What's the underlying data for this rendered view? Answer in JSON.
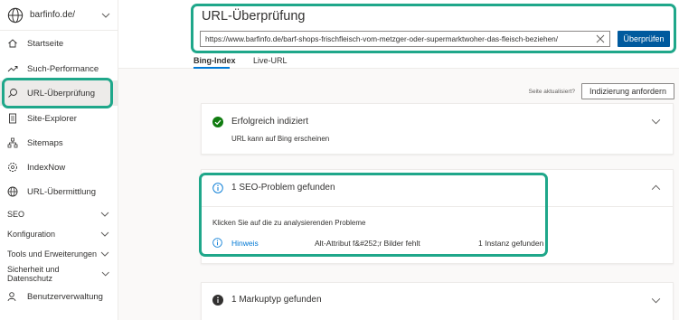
{
  "site": {
    "name": "barfinfo.de/"
  },
  "sidebar": {
    "items": [
      {
        "label": "Startseite",
        "icon": "home-icon"
      },
      {
        "label": "Such-Performance",
        "icon": "trend-icon"
      },
      {
        "label": "URL-Überprüfung",
        "icon": "search-icon"
      },
      {
        "label": "Site-Explorer",
        "icon": "document-icon"
      },
      {
        "label": "Sitemaps",
        "icon": "sitemap-icon"
      },
      {
        "label": "IndexNow",
        "icon": "indexnow-icon"
      },
      {
        "label": "URL-Übermittlung",
        "icon": "globe-icon"
      }
    ],
    "sections": [
      {
        "label": "SEO"
      },
      {
        "label": "Konfiguration"
      },
      {
        "label": "Tools und Erweiterungen"
      },
      {
        "label": "Sicherheit und Datenschutz"
      }
    ],
    "user_management": {
      "label": "Benutzerverwaltung",
      "icon": "users-icon"
    }
  },
  "header": {
    "title": "URL-Überprüfung",
    "url_value": "https://www.barfinfo.de/barf-shops-frischfleisch-vom-metzger-oder-supermarktwoher-das-fleisch-beziehen/",
    "inspect_button": "Überprüfen",
    "tabs": [
      {
        "label": "Bing-Index"
      },
      {
        "label": "Live-URL"
      }
    ]
  },
  "main": {
    "refresh_label": "Seite aktualisiert?",
    "request_button": "Indizierung anfordern",
    "cards": {
      "indexed": {
        "title": "Erfolgreich indiziert",
        "subtitle": "URL kann auf Bing erscheinen"
      },
      "seo": {
        "title": "1 SEO-Problem gefunden",
        "instruction": "Klicken Sie auf die zu analysierenden Probleme",
        "hint": {
          "type": "Hinweis",
          "issue": "Alt-Attribut f&#252;r Bilder fehlt",
          "count": "1 Instanz gefunden"
        }
      },
      "markup": {
        "title": "1 Markuptyp gefunden"
      }
    }
  },
  "colors": {
    "accent": "#0078d4",
    "button": "#005a9e",
    "success": "#107c10",
    "highlight": "#1fa78a"
  }
}
